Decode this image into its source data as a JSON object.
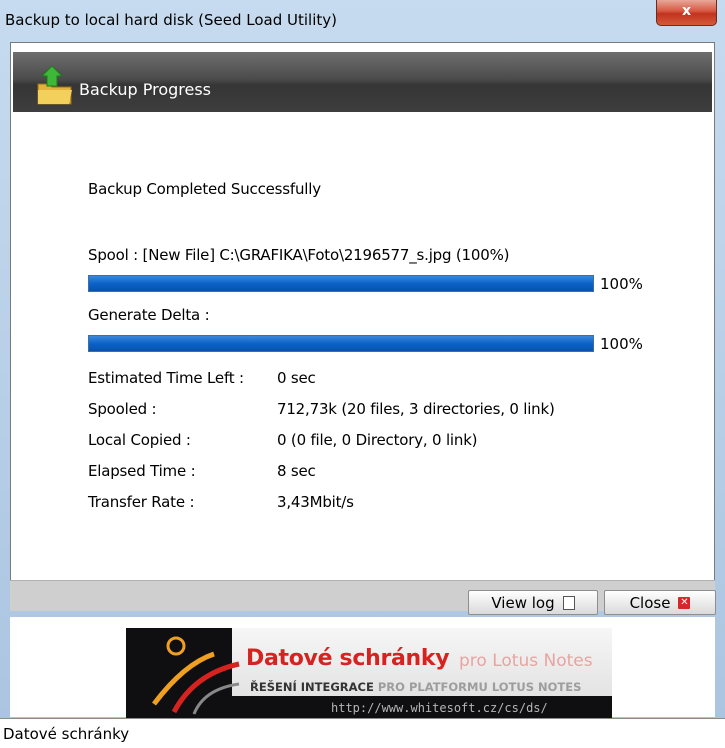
{
  "window": {
    "title": "Backup to local hard disk (Seed Load Utility)",
    "close_glyph": "x"
  },
  "header": {
    "title": "Backup Progress",
    "icon": "folder-arrow-icon"
  },
  "progress": {
    "status": "Backup Completed Successfully",
    "spool_label": "Spool :  [New File] C:\\GRAFIKA\\Foto\\2196577_s.jpg (100%)",
    "spool_value": 1.0,
    "spool_pct": "100%",
    "delta_label": "Generate Delta :",
    "delta_value": 1.0,
    "delta_pct": "100%",
    "bar_color": "#0b63c8"
  },
  "stats": [
    {
      "label": "Estimated Time Left :",
      "value": "0 sec"
    },
    {
      "label": "Spooled :",
      "value": "712,73k (20 files, 3 directories, 0 link)"
    },
    {
      "label": "Local Copied :",
      "value": "0 (0 file, 0 Directory, 0 link)"
    },
    {
      "label": "Elapsed Time :",
      "value": "8 sec"
    },
    {
      "label": "Transfer Rate :",
      "value": "3,43Mbit/s"
    }
  ],
  "buttons": {
    "view_log": "View log",
    "close": "Close"
  },
  "banner": {
    "title": "Datové schránky",
    "title_suffix": "pro Lotus Notes",
    "subtitle_bold": "ŘEŠENÍ INTEGRACE",
    "subtitle_rest": "PRO PLATFORMU LOTUS NOTES",
    "url": "http://www.whitesoft.cz/cs/ds/"
  },
  "statusbar": {
    "text": "Datové schránky"
  }
}
